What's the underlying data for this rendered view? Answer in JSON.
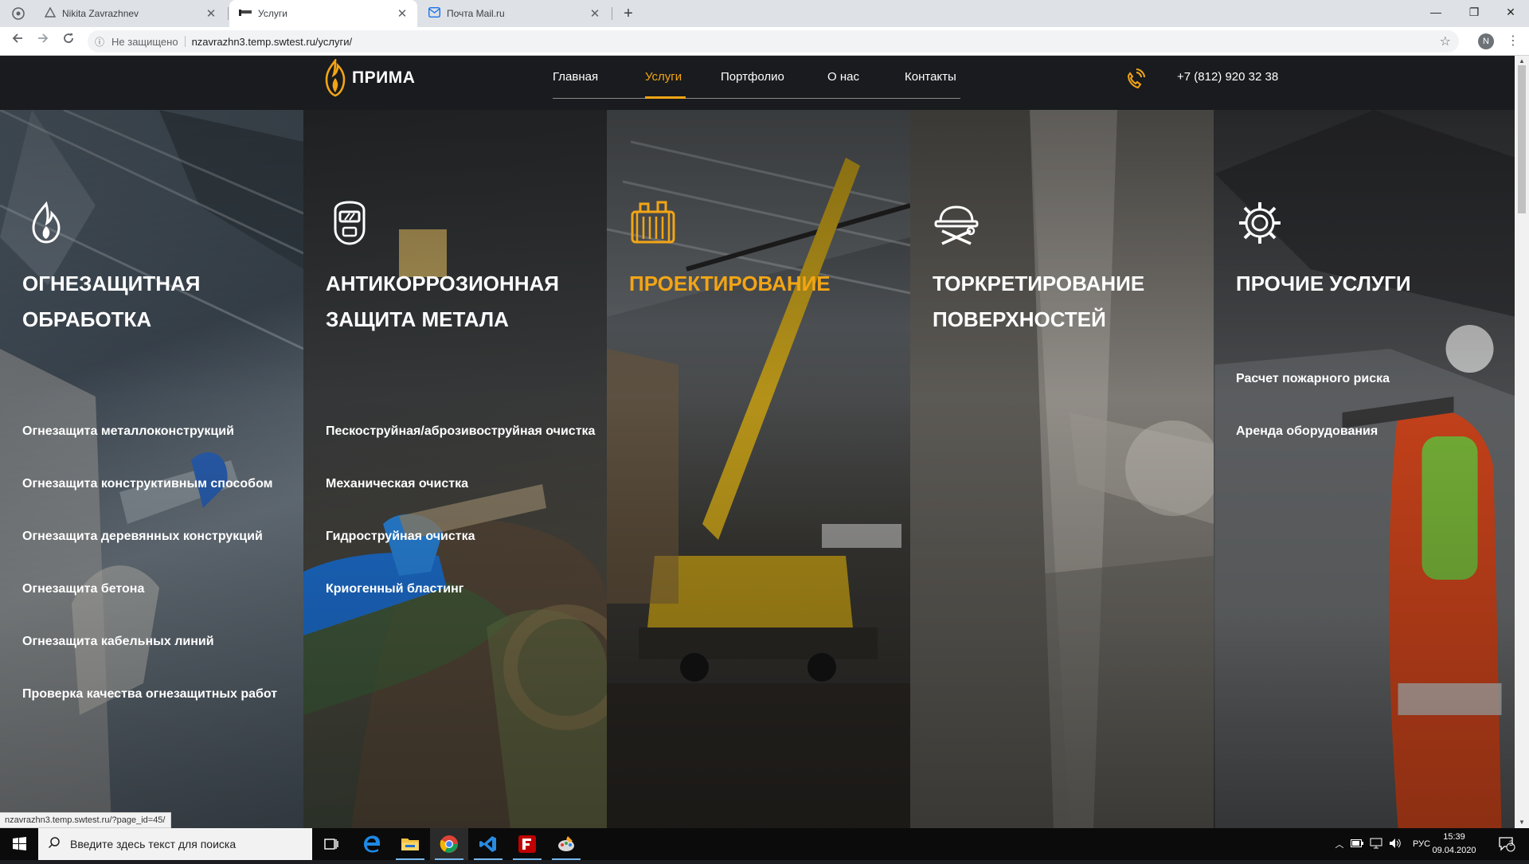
{
  "browser": {
    "tabs": [
      {
        "title": "Nikita Zavrazhnev",
        "icon": "triangle-drive-icon"
      },
      {
        "title": "Услуги",
        "icon": "site-flag-icon"
      },
      {
        "title": "Почта Mail.ru",
        "icon": "mail-envelope-icon"
      }
    ],
    "active_tab": 1,
    "security_label": "Не защищено",
    "url": "nzavrazhn3.temp.swtest.ru/услуги/",
    "profile_initial": "N",
    "status_url": "nzavrazhn3.temp.swtest.ru/?page_id=45/"
  },
  "site": {
    "logo_text": "ПРИМА",
    "nav": [
      {
        "label": "Главная",
        "active": false
      },
      {
        "label": "Услуги",
        "active": true
      },
      {
        "label": "Портфолио",
        "active": false
      },
      {
        "label": "О нас",
        "active": false
      },
      {
        "label": "Контакты",
        "active": false
      }
    ],
    "phone": "+7 (812) 920 32 38",
    "accent_color": "#f3a515"
  },
  "services": [
    {
      "title": "Огнезащитная обработка",
      "icon": "flame-icon",
      "highlight": false,
      "items": [
        "Огнезащита металлоконструкций",
        "Огнезащита конструктивным способом",
        "Огнезащита деревянных конструкций",
        "Огнезащита бетона",
        "Огнезащита кабельных линий",
        "Проверка качества огнезащитных работ"
      ]
    },
    {
      "title": "Антикоррозионная защита метала",
      "icon": "welding-mask-icon",
      "highlight": false,
      "items": [
        "Пескоструйная/аброзивоструйная очистка",
        "Механическая очистка",
        "Гидроструйная очистка",
        "Криогенный бластинг"
      ]
    },
    {
      "title": "Проектирование",
      "icon": "blueprint-icon",
      "highlight": true,
      "items": []
    },
    {
      "title": "Торкретирование поверхностей",
      "icon": "hardhat-tools-icon",
      "highlight": false,
      "items": []
    },
    {
      "title": "Прочие услуги",
      "icon": "gear-icon",
      "highlight": false,
      "items": [
        "Расчет пожарного риска",
        "Аренда оборудования"
      ]
    }
  ],
  "taskbar": {
    "search_placeholder": "Введите здесь текст для поиска",
    "apps": [
      "task-view-icon",
      "edge-icon",
      "file-explorer-icon",
      "chrome-icon",
      "vscode-icon",
      "filezilla-icon",
      "paint-icon"
    ],
    "language": "РУС",
    "time": "15:39",
    "date": "09.04.2020",
    "notifications": "3"
  }
}
